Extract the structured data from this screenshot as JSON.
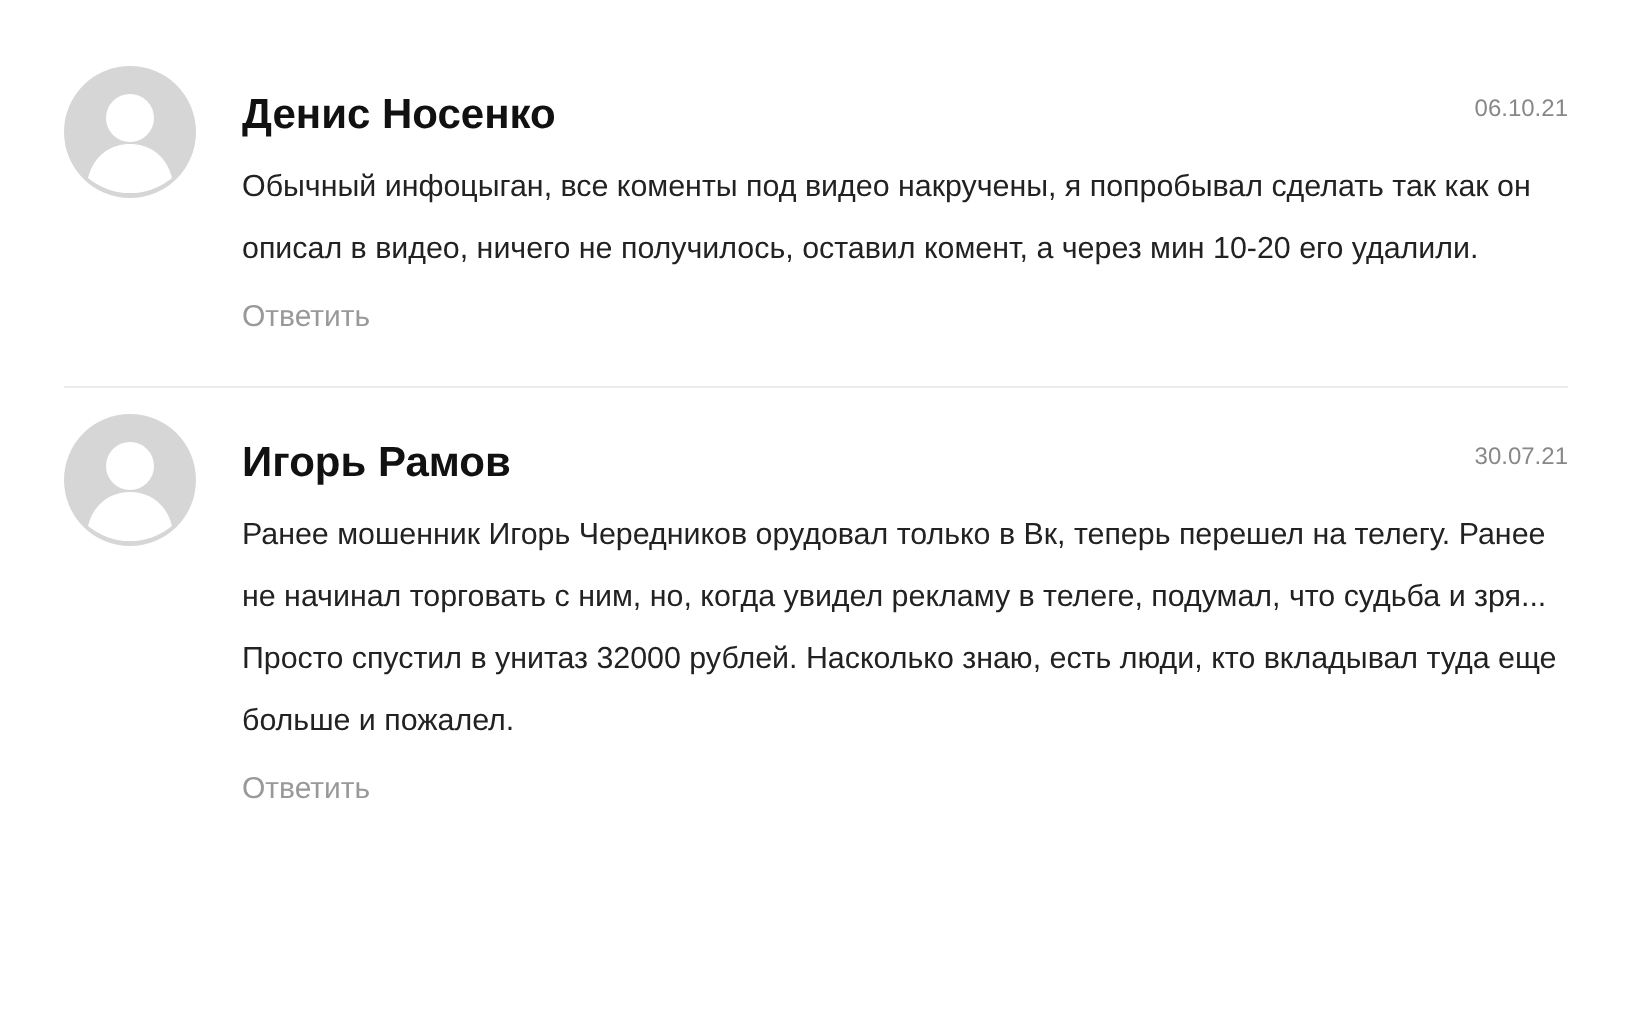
{
  "comments": [
    {
      "author": "Денис Носенко",
      "date": "06.10.21",
      "text": "Обычный инфоцыган, все коменты под видео накручены, я попробывал сделать так как он описал в видео, ничего не получилось, оставил комент, а через мин 10-20 его удалили.",
      "reply": "Ответить"
    },
    {
      "author": "Игорь Рамов",
      "date": "30.07.21",
      "text": "Ранее мошенник Игорь Чередников орудовал только в Вк, теперь перешел на телегу. Ранее не начинал торговать с ним, но, когда увидел рекламу в телеге, подумал, что судьба и зря... Просто спустил в унитаз 32000 рублей. Насколько знаю, есть люди, кто вкладывал туда еще больше и пожалел.",
      "reply": "Ответить"
    }
  ]
}
